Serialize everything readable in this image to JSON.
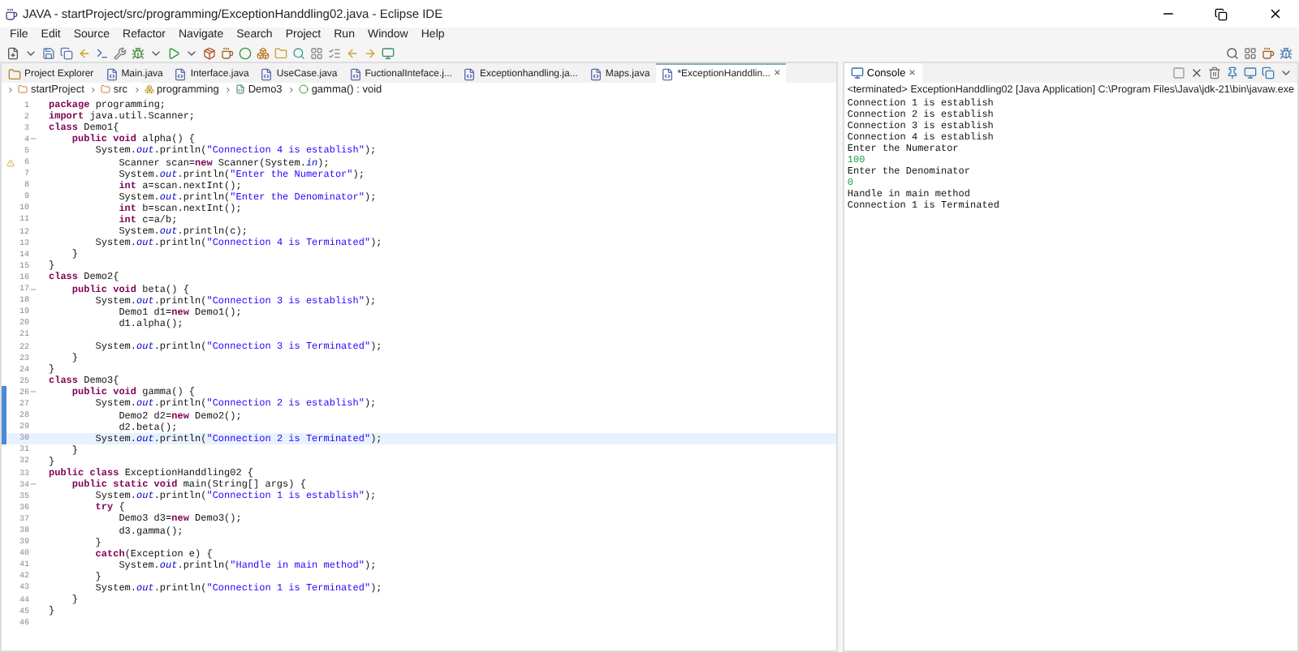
{
  "window": {
    "title": "JAVA - startProject/src/programming/ExceptionHanddling02.java - Eclipse IDE"
  },
  "menu": [
    "File",
    "Edit",
    "Source",
    "Refactor",
    "Navigate",
    "Search",
    "Project",
    "Run",
    "Window",
    "Help"
  ],
  "editor_tabs": [
    {
      "label": "Project Explorer",
      "kind": "view",
      "selected": false
    },
    {
      "label": "Main.java",
      "kind": "file",
      "selected": false
    },
    {
      "label": "Interface.java",
      "kind": "file",
      "selected": false
    },
    {
      "label": "UseCase.java",
      "kind": "file",
      "selected": false
    },
    {
      "label": "FuctionalInteface.j...",
      "kind": "file",
      "selected": false
    },
    {
      "label": "Exceptionhandling.ja...",
      "kind": "file",
      "selected": false
    },
    {
      "label": "Maps.java",
      "kind": "file",
      "selected": false
    },
    {
      "label": "*ExceptionHanddlin...",
      "kind": "file",
      "selected": true,
      "close": "×"
    }
  ],
  "breadcrumb": [
    {
      "label": "startProject",
      "kind": "project"
    },
    {
      "label": "src",
      "kind": "folder"
    },
    {
      "label": "programming",
      "kind": "package"
    },
    {
      "label": "Demo3",
      "kind": "class"
    },
    {
      "label": "gamma() : void",
      "kind": "method"
    }
  ],
  "code_lines": [
    {
      "number": "1",
      "segs": [
        {
          "kind": "keyword",
          "text": "package"
        },
        {
          "kind": "plain",
          "text": " programming;"
        }
      ]
    },
    {
      "number": "2",
      "segs": [
        {
          "kind": "keyword",
          "text": "import"
        },
        {
          "kind": "plain",
          "text": " java.util.Scanner;"
        }
      ]
    },
    {
      "number": "3",
      "segs": [
        {
          "kind": "keyword",
          "text": "class"
        },
        {
          "kind": "plain",
          "text": " Demo1{"
        }
      ]
    },
    {
      "number": "4",
      "fold": true,
      "segs": [
        {
          "kind": "keyword",
          "text": "    public void"
        },
        {
          "kind": "plain",
          "text": " alpha() {"
        }
      ]
    },
    {
      "number": "5",
      "segs": [
        {
          "kind": "plain",
          "text": "        System."
        },
        {
          "kind": "field",
          "text": "out"
        },
        {
          "kind": "plain",
          "text": ".println("
        },
        {
          "kind": "string",
          "text": "\"Connection 4 is establish\""
        },
        {
          "kind": "plain",
          "text": ");"
        }
      ]
    },
    {
      "number": "6",
      "warning": true,
      "segs": [
        {
          "kind": "plain",
          "text": "            Scanner scan="
        },
        {
          "kind": "keyword",
          "text": "new"
        },
        {
          "kind": "plain",
          "text": " Scanner(System."
        },
        {
          "kind": "field",
          "text": "in"
        },
        {
          "kind": "plain",
          "text": ");"
        }
      ]
    },
    {
      "number": "7",
      "segs": [
        {
          "kind": "plain",
          "text": "            System."
        },
        {
          "kind": "field",
          "text": "out"
        },
        {
          "kind": "plain",
          "text": ".println("
        },
        {
          "kind": "string",
          "text": "\"Enter the Numerator\""
        },
        {
          "kind": "plain",
          "text": ");"
        }
      ]
    },
    {
      "number": "8",
      "segs": [
        {
          "kind": "keyword",
          "text": "            int"
        },
        {
          "kind": "plain",
          "text": " a=scan.nextInt();"
        }
      ]
    },
    {
      "number": "9",
      "segs": [
        {
          "kind": "plain",
          "text": "            System."
        },
        {
          "kind": "field",
          "text": "out"
        },
        {
          "kind": "plain",
          "text": ".println("
        },
        {
          "kind": "string",
          "text": "\"Enter the Denominator\""
        },
        {
          "kind": "plain",
          "text": ");"
        }
      ]
    },
    {
      "number": "10",
      "segs": [
        {
          "kind": "keyword",
          "text": "            int"
        },
        {
          "kind": "plain",
          "text": " b=scan.nextInt();"
        }
      ]
    },
    {
      "number": "11",
      "segs": [
        {
          "kind": "keyword",
          "text": "            int"
        },
        {
          "kind": "plain",
          "text": " c=a/b;"
        }
      ]
    },
    {
      "number": "12",
      "segs": [
        {
          "kind": "plain",
          "text": "            System."
        },
        {
          "kind": "field",
          "text": "out"
        },
        {
          "kind": "plain",
          "text": ".println(c);"
        }
      ]
    },
    {
      "number": "13",
      "segs": [
        {
          "kind": "plain",
          "text": "        System."
        },
        {
          "kind": "field",
          "text": "out"
        },
        {
          "kind": "plain",
          "text": ".println("
        },
        {
          "kind": "string",
          "text": "\"Connection 4 is Terminated\""
        },
        {
          "kind": "plain",
          "text": ");"
        }
      ]
    },
    {
      "number": "14",
      "segs": [
        {
          "kind": "plain",
          "text": "    }"
        }
      ]
    },
    {
      "number": "15",
      "segs": [
        {
          "kind": "plain",
          "text": "}"
        }
      ]
    },
    {
      "number": "16",
      "segs": [
        {
          "kind": "keyword",
          "text": "class"
        },
        {
          "kind": "plain",
          "text": " Demo2{"
        }
      ]
    },
    {
      "number": "17",
      "fold": true,
      "segs": [
        {
          "kind": "keyword",
          "text": "    public void"
        },
        {
          "kind": "plain",
          "text": " beta() {"
        }
      ]
    },
    {
      "number": "18",
      "segs": [
        {
          "kind": "plain",
          "text": "        System."
        },
        {
          "kind": "field",
          "text": "out"
        },
        {
          "kind": "plain",
          "text": ".println("
        },
        {
          "kind": "string",
          "text": "\"Connection 3 is establish\""
        },
        {
          "kind": "plain",
          "text": ");"
        }
      ]
    },
    {
      "number": "19",
      "segs": [
        {
          "kind": "plain",
          "text": "            Demo1 d1="
        },
        {
          "kind": "keyword",
          "text": "new"
        },
        {
          "kind": "plain",
          "text": " Demo1();"
        }
      ]
    },
    {
      "number": "20",
      "segs": [
        {
          "kind": "plain",
          "text": "            d1.alpha();"
        }
      ]
    },
    {
      "number": "21"
    },
    {
      "number": "22",
      "segs": [
        {
          "kind": "plain",
          "text": "        System."
        },
        {
          "kind": "field",
          "text": "out"
        },
        {
          "kind": "plain",
          "text": ".println("
        },
        {
          "kind": "string",
          "text": "\"Connection 3 is Terminated\""
        },
        {
          "kind": "plain",
          "text": ");"
        }
      ]
    },
    {
      "number": "23",
      "segs": [
        {
          "kind": "plain",
          "text": "    }"
        }
      ]
    },
    {
      "number": "24",
      "segs": [
        {
          "kind": "plain",
          "text": "}"
        }
      ]
    },
    {
      "number": "25",
      "segs": [
        {
          "kind": "keyword",
          "text": "class"
        },
        {
          "kind": "plain",
          "text": " Demo3{"
        }
      ]
    },
    {
      "number": "26",
      "fold": true,
      "changed": true,
      "segs": [
        {
          "kind": "keyword",
          "text": "    public void"
        },
        {
          "kind": "plain",
          "text": " gamma() {"
        }
      ]
    },
    {
      "number": "27",
      "changed": true,
      "segs": [
        {
          "kind": "plain",
          "text": "        System."
        },
        {
          "kind": "field",
          "text": "out"
        },
        {
          "kind": "plain",
          "text": ".println("
        },
        {
          "kind": "string",
          "text": "\"Connection 2 is establish\""
        },
        {
          "kind": "plain",
          "text": ");"
        }
      ]
    },
    {
      "number": "28",
      "changed": true,
      "segs": [
        {
          "kind": "plain",
          "text": "            Demo2 d2="
        },
        {
          "kind": "keyword",
          "text": "new"
        },
        {
          "kind": "plain",
          "text": " Demo2();"
        }
      ]
    },
    {
      "number": "29",
      "changed": true,
      "segs": [
        {
          "kind": "plain",
          "text": "            d2.beta();"
        }
      ]
    },
    {
      "number": "30",
      "changed": true,
      "current": true,
      "segs": [
        {
          "kind": "plain",
          "text": "        System."
        },
        {
          "kind": "field",
          "text": "out"
        },
        {
          "kind": "plain",
          "text": ".println("
        },
        {
          "kind": "string",
          "text": "\"Connection 2 is Terminated\""
        },
        {
          "kind": "plain",
          "text": ");"
        }
      ]
    },
    {
      "number": "31",
      "segs": [
        {
          "kind": "plain",
          "text": "    }"
        }
      ]
    },
    {
      "number": "32",
      "segs": [
        {
          "kind": "plain",
          "text": "}"
        }
      ]
    },
    {
      "number": "33",
      "segs": [
        {
          "kind": "keyword",
          "text": "public class"
        },
        {
          "kind": "plain",
          "text": " ExceptionHanddling02 {"
        }
      ]
    },
    {
      "number": "34",
      "fold": true,
      "segs": [
        {
          "kind": "keyword",
          "text": "    public static void"
        },
        {
          "kind": "plain",
          "text": " main(String[] args) {"
        }
      ]
    },
    {
      "number": "35",
      "segs": [
        {
          "kind": "plain",
          "text": "        System."
        },
        {
          "kind": "field",
          "text": "out"
        },
        {
          "kind": "plain",
          "text": ".println("
        },
        {
          "kind": "string",
          "text": "\"Connection 1 is establish\""
        },
        {
          "kind": "plain",
          "text": ");"
        }
      ]
    },
    {
      "number": "36",
      "segs": [
        {
          "kind": "keyword",
          "text": "        try"
        },
        {
          "kind": "plain",
          "text": " {"
        }
      ]
    },
    {
      "number": "37",
      "segs": [
        {
          "kind": "plain",
          "text": "            Demo3 d3="
        },
        {
          "kind": "keyword",
          "text": "new"
        },
        {
          "kind": "plain",
          "text": " Demo3();"
        }
      ]
    },
    {
      "number": "38",
      "segs": [
        {
          "kind": "plain",
          "text": "            d3.gamma();"
        }
      ]
    },
    {
      "number": "39",
      "segs": [
        {
          "kind": "plain",
          "text": "        }"
        }
      ]
    },
    {
      "number": "40",
      "segs": [
        {
          "kind": "keyword",
          "text": "        catch"
        },
        {
          "kind": "plain",
          "text": "(Exception e) {"
        }
      ]
    },
    {
      "number": "41",
      "segs": [
        {
          "kind": "plain",
          "text": "            System."
        },
        {
          "kind": "field",
          "text": "out"
        },
        {
          "kind": "plain",
          "text": ".println("
        },
        {
          "kind": "string",
          "text": "\"Handle in main method\""
        },
        {
          "kind": "plain",
          "text": ");"
        }
      ]
    },
    {
      "number": "42",
      "segs": [
        {
          "kind": "plain",
          "text": "        }"
        }
      ]
    },
    {
      "number": "43",
      "segs": [
        {
          "kind": "plain",
          "text": "        System."
        },
        {
          "kind": "field",
          "text": "out"
        },
        {
          "kind": "plain",
          "text": ".println("
        },
        {
          "kind": "string",
          "text": "\"Connection 1 is Terminated\""
        },
        {
          "kind": "plain",
          "text": ");"
        }
      ]
    },
    {
      "number": "44",
      "segs": [
        {
          "kind": "plain",
          "text": "    }"
        }
      ]
    },
    {
      "number": "45",
      "segs": [
        {
          "kind": "plain",
          "text": "}"
        }
      ]
    },
    {
      "number": "46"
    }
  ],
  "console": {
    "tab": {
      "label": "Console",
      "close": "×",
      "selected": true
    },
    "status": "<terminated> ExceptionHanddling02 [Java Application] C:\\Program Files\\Java\\jdk-21\\bin\\javaw.exe",
    "lines": [
      {
        "text": "Connection 1 is establish",
        "kind": "output"
      },
      {
        "text": "Connection 2 is establish",
        "kind": "output"
      },
      {
        "text": "Connection 3 is establish",
        "kind": "output"
      },
      {
        "text": "Connection 4 is establish",
        "kind": "output"
      },
      {
        "text": "Enter the Numerator",
        "kind": "output"
      },
      {
        "text": "100",
        "kind": "input"
      },
      {
        "text": "Enter the Denominator",
        "kind": "output"
      },
      {
        "text": "0",
        "kind": "input"
      },
      {
        "text": "Handle in main method",
        "kind": "output"
      },
      {
        "text": "Connection 1 is Terminated",
        "kind": "output"
      }
    ]
  }
}
